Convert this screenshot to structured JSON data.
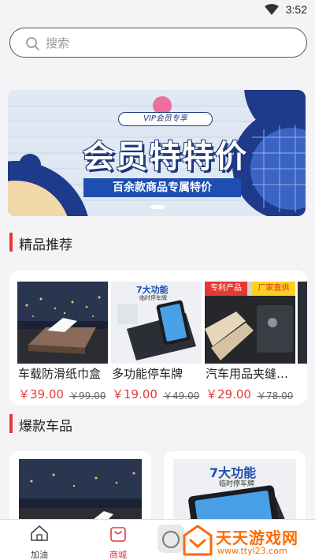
{
  "status_bar": {
    "time": "3:52"
  },
  "search": {
    "placeholder": "搜索"
  },
  "banner": {
    "tag": "VIP会员专享",
    "title": "会员特特价",
    "subtitle": "百余款商品专属特价"
  },
  "sections": [
    {
      "title": "精品推荐"
    },
    {
      "title": "爆款车品"
    }
  ],
  "products": [
    {
      "name": "车载防滑纸巾盒",
      "price": "￥39.00",
      "old_price": "￥99.00"
    },
    {
      "name": "多功能停车牌",
      "price": "￥19.00",
      "old_price": "￥49.00",
      "badge": "7大功能",
      "badge_sub": "临时停车牌"
    },
    {
      "name": "汽车用品夹缝收纳盒",
      "price": "￥29.00",
      "old_price": "￥78.00",
      "badge": "专利产品",
      "badge2": "厂家直供"
    }
  ],
  "hot_products": [
    {
      "badge": "7大功能",
      "badge_sub": "临时停车牌"
    }
  ],
  "bottom_nav": {
    "items": [
      {
        "label": "加油"
      },
      {
        "label": "商城"
      }
    ]
  },
  "watermark": {
    "text": "天天游戏网",
    "url": "www.ttyl23.com"
  },
  "colors": {
    "accent": "#e53935",
    "banner_blue": "#1e4fb0",
    "watermark": "#ff6a00"
  }
}
